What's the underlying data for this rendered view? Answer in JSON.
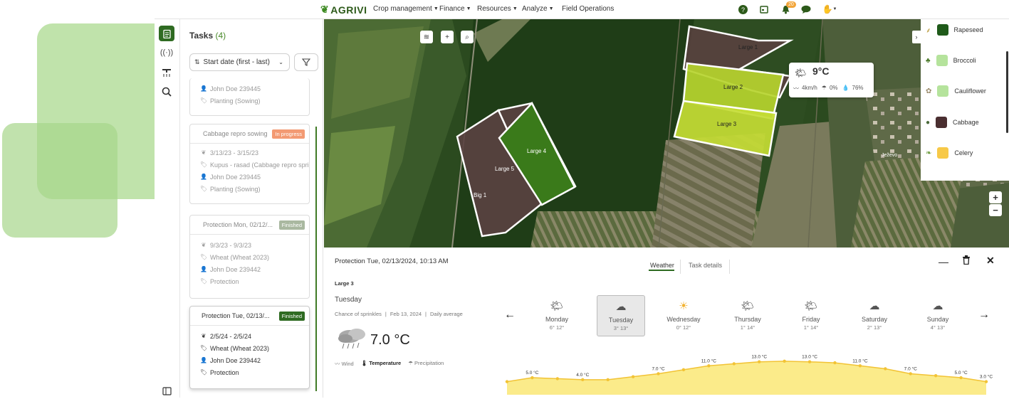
{
  "nav": {
    "logo": "AGRIVI",
    "menu": [
      {
        "label": "Crop management"
      },
      {
        "label": "Finance"
      },
      {
        "label": "Resources"
      },
      {
        "label": "Analyze"
      },
      {
        "label": "Field Operations"
      }
    ],
    "notifications_count": "20",
    "icons": [
      "help-icon",
      "calendar-icon",
      "bell-icon",
      "chat-icon",
      "user-menu-icon"
    ]
  },
  "tasks": {
    "title": "Tasks",
    "count": "(4)",
    "sort_label": "Start date (first - last)",
    "cards": [
      {
        "partial": true,
        "rows": [
          "John Doe 239445",
          "Planting (Sowing)"
        ]
      },
      {
        "title": "Cabbage repro sowing",
        "status": "In progress",
        "status_color": "#f39a73",
        "rows": [
          "3/13/23 - 3/15/23",
          "Kupus - rasad (Cabbage repro spri...",
          "John Doe 239445",
          "Planting (Sowing)"
        ]
      },
      {
        "title": "Protection Mon, 02/12/...",
        "status": "Finished",
        "status_color": "#a9b8a0",
        "rows": [
          "9/3/23 - 9/3/23",
          "Wheat (Wheat 2023)",
          "John Doe 239442",
          "Protection"
        ]
      },
      {
        "title": "Protection Tue, 02/13/...",
        "status": "Finished",
        "status_color": "#2f6b22",
        "rows": [
          "2/5/24 - 2/5/24",
          "Wheat (Wheat 2023)",
          "John Doe 239442",
          "Protection"
        ]
      }
    ]
  },
  "map": {
    "fields": [
      "Large 1",
      "Large 2",
      "Large 3",
      "Large 4",
      "Large 5",
      "Big 1"
    ],
    "town": "Ježevo",
    "weather_popup": {
      "temp": "9°C",
      "wind": "4km/h",
      "rain": "0%",
      "humidity": "76%"
    },
    "zoom_in": "+",
    "zoom_out": "−"
  },
  "legend": [
    {
      "label": "Rapeseed",
      "color": "#1f5a1a"
    },
    {
      "label": "Broccoli",
      "color": "#b5e39c"
    },
    {
      "label": "Cauliflower",
      "color": "#b5e39c"
    },
    {
      "label": "Cabbage",
      "color": "#4a2e30"
    },
    {
      "label": "Celery",
      "color": "#f7c948"
    }
  ],
  "detail": {
    "title": "Protection Tue, 02/13/2024, 10:13 AM",
    "field": "Large 3",
    "tabs": [
      "Weather",
      "Task details"
    ],
    "day": "Tuesday",
    "info": [
      "Chance of sprinkles",
      "Feb 13, 2024",
      "Daily average"
    ],
    "temp": "7.0 °C",
    "modes": [
      "Wind",
      "Temperature",
      "Precipitation"
    ],
    "days": [
      {
        "name": "Monday",
        "range": "6° 12°",
        "icon": "partly-sunny-icon"
      },
      {
        "name": "Tuesday",
        "range": "3° 13°",
        "icon": "cloudy-icon"
      },
      {
        "name": "Wednesday",
        "range": "0° 12°",
        "icon": "sunny-icon"
      },
      {
        "name": "Thursday",
        "range": "1° 14°",
        "icon": "partly-sunny-icon"
      },
      {
        "name": "Friday",
        "range": "1° 14°",
        "icon": "partly-sunny-icon"
      },
      {
        "name": "Saturday",
        "range": "2° 13°",
        "icon": "cloudy-icon"
      },
      {
        "name": "Sunday",
        "range": "4° 13°",
        "icon": "cloudy-icon"
      }
    ]
  },
  "chart_data": {
    "type": "area",
    "x": [
      0,
      1,
      2,
      3,
      4,
      5,
      6,
      7,
      8,
      9,
      10,
      11,
      12,
      13,
      14,
      15,
      16,
      17,
      18,
      19
    ],
    "values": [
      3,
      5,
      4.5,
      4,
      4,
      5.5,
      7,
      9,
      11,
      12,
      13,
      13.3,
      13,
      12.5,
      11,
      9.5,
      7,
      6,
      5,
      3
    ],
    "labels": [
      {
        "i": 1,
        "text": "5.0 °C"
      },
      {
        "i": 3,
        "text": "4.0 °C"
      },
      {
        "i": 6,
        "text": "7.0 °C"
      },
      {
        "i": 8,
        "text": "11.0 °C"
      },
      {
        "i": 10,
        "text": "13.0 °C"
      },
      {
        "i": 12,
        "text": "13.0 °C"
      },
      {
        "i": 14,
        "text": "11.0 °C"
      },
      {
        "i": 16,
        "text": "7.0 °C"
      },
      {
        "i": 18,
        "text": "5.0 °C"
      },
      {
        "i": 19,
        "text": "3.0 °C"
      }
    ],
    "color": "#f2c335"
  }
}
